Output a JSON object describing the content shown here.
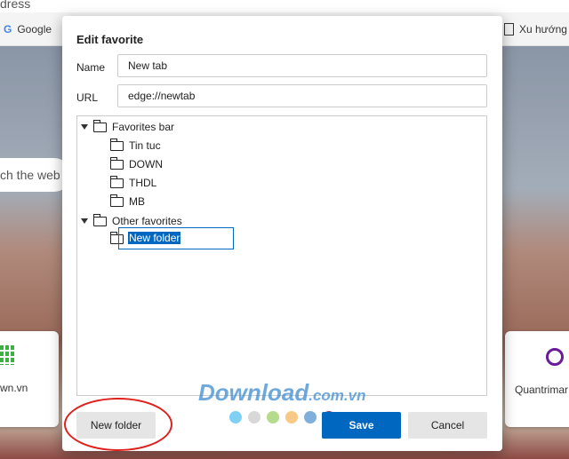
{
  "browser": {
    "address_text": "dress",
    "bookmarks": [
      {
        "label": "Google",
        "icon": "google-icon"
      },
      {
        "label": "Xu hướng",
        "icon": "page-icon"
      }
    ],
    "search_partial": "ch the web",
    "tiles": [
      {
        "label": "wn.vn",
        "icon": "grid-icon",
        "color": "#3cb043"
      },
      {
        "label": "Quantrimar",
        "icon": "quantrimang-icon",
        "color": "#6a1b9a"
      }
    ]
  },
  "dialog": {
    "title": "Edit favorite",
    "name_label": "Name",
    "name_value": "New tab",
    "url_label": "URL",
    "url_value": "edge://newtab",
    "tree": {
      "favorites_bar": "Favorites bar",
      "children": [
        "Tin tuc",
        "DOWN",
        "THDL",
        "MB"
      ],
      "other": "Other favorites",
      "new_folder_edit": "New folder"
    },
    "new_folder_button": "New folder",
    "save_button": "Save",
    "cancel_button": "Cancel",
    "accent": "#0067c0"
  },
  "watermark": {
    "main": "Download",
    "suffix": ".com.vn",
    "dot_colors": [
      "#7fd0f5",
      "#d8d8d8",
      "#b5dc8c",
      "#f8c886",
      "#7fb0dc",
      "#8b3a7a"
    ]
  }
}
